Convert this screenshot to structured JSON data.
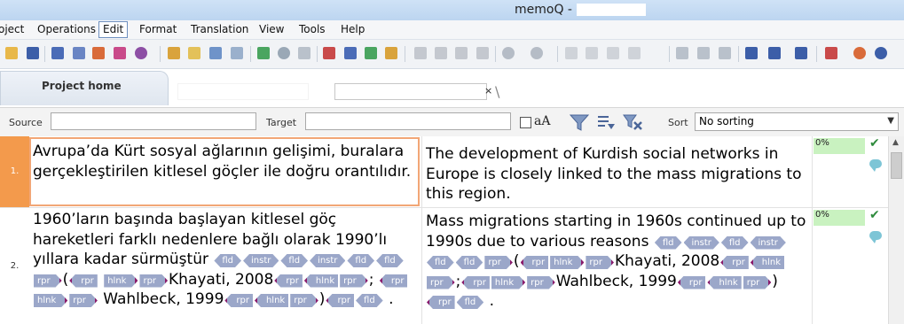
{
  "window": {
    "title": "memoQ - "
  },
  "menu": [
    "oject",
    "Operations",
    "Edit",
    "Format",
    "Translation",
    "View",
    "Tools",
    "Help"
  ],
  "menu_active": "Edit",
  "toolbar_icons": [
    "open-icon",
    "save-icon",
    "statistics-icon",
    "sort-icon",
    "import-icon",
    "export-icon",
    "web-icon",
    "chart-icon",
    "pretranslate-icon",
    "edit-icon",
    "review-icon",
    "confirm-icon",
    "refresh-icon",
    "check-icon",
    "concordance-icon",
    "lookup-icon",
    "add-term-icon",
    "add-tm-icon",
    "cut-icon",
    "copy-icon",
    "paste-icon",
    "find-icon",
    "undo-icon",
    "redo-icon",
    "bold-icon",
    "italic-icon",
    "underline-icon",
    "braces-icon",
    "settings-icon",
    "tag-icon",
    "fill-icon",
    "insert-icon",
    "omega-icon",
    "copy-source-icon",
    "spellcheck-icon",
    "sync-icon",
    "qa-icon"
  ],
  "tabs": {
    "home": "Project home",
    "doc2_close": "×",
    "doc2_slash": "\\"
  },
  "filter": {
    "source_label": "Source",
    "target_label": "Target",
    "case_label": "aA",
    "sort_label": "Sort",
    "sort_value": "No sorting",
    "source_value": "",
    "target_value": ""
  },
  "segments": [
    {
      "num": "1.",
      "source": "Avrupa’da Kürt sosyal ağlarının gelişimi, buralara gerçekleştirilen kitlesel göçler ile doğru orantılıdır.",
      "target": "The development of Kurdish social networks in Europe is closely linked to the mass migrations to this region.",
      "match": "0%"
    },
    {
      "num": "2.",
      "source_parts": {
        "a": "1960’ların başında başlayan kitlesel göç hareketleri farklı nedenlere bağlı olarak 1990’lı yıllara kadar sürmüştür",
        "b": "(",
        "c": "Khayati, 2008",
        "d": ";",
        "e": "Wahlbeck, 1999",
        "f": ")",
        "g": "."
      },
      "target_parts": {
        "a": "Mass migrations starting in 1960s continued up to 1990s due to various reasons",
        "b": "(",
        "c": "Khayati, 2008",
        "d": ";",
        "e": "Wahlbeck, 1999",
        "f": ")",
        "g": "."
      },
      "tags": {
        "fld": "fld",
        "instr": "instr",
        "rpr": "rpr",
        "hlnk": "hlnk"
      },
      "match": "0%"
    }
  ],
  "colors": {
    "active_row": "#f39a4c",
    "tag": "#9ba7c9",
    "match_bg": "#c9f2c0"
  }
}
